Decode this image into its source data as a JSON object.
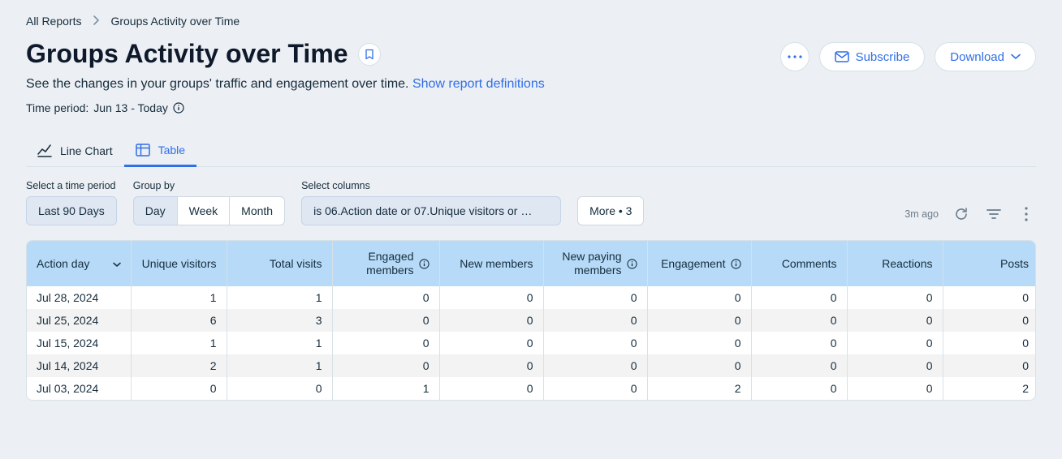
{
  "breadcrumb": {
    "root": "All Reports",
    "current": "Groups Activity over Time"
  },
  "header": {
    "title": "Groups Activity over Time",
    "subtitle": "See the changes in your groups' traffic and engagement over time.",
    "definitions_link": "Show report definitions",
    "time_period_label": "Time period:",
    "time_period_value": "Jun 13 - Today"
  },
  "actions": {
    "subscribe": "Subscribe",
    "download": "Download"
  },
  "tabs": {
    "line_chart": "Line Chart",
    "table": "Table",
    "active": "table"
  },
  "controls": {
    "time_period_label": "Select a time period",
    "time_period_value": "Last 90 Days",
    "group_by_label": "Group by",
    "group_by_options": [
      "Day",
      "Week",
      "Month"
    ],
    "group_by_active": "Day",
    "columns_label": "Select columns",
    "columns_summary": "is 06.Action date or 07.Unique visitors or …",
    "more_label": "More • 3",
    "age": "3m ago"
  },
  "table": {
    "columns": [
      {
        "key": "action_day",
        "label": "Action day",
        "numeric": false,
        "sort": true
      },
      {
        "key": "unique_visitors",
        "label": "Unique visitors",
        "numeric": true
      },
      {
        "key": "total_visits",
        "label": "Total visits",
        "numeric": true
      },
      {
        "key": "engaged_members",
        "label": "Engaged members",
        "numeric": true,
        "info": true,
        "multiline": true
      },
      {
        "key": "new_members",
        "label": "New members",
        "numeric": true
      },
      {
        "key": "new_paying_members",
        "label": "New paying members",
        "numeric": true,
        "info": true,
        "multiline": true
      },
      {
        "key": "engagement",
        "label": "Engagement",
        "numeric": true,
        "info": true
      },
      {
        "key": "comments",
        "label": "Comments",
        "numeric": true
      },
      {
        "key": "reactions",
        "label": "Reactions",
        "numeric": true
      },
      {
        "key": "posts",
        "label": "Posts",
        "numeric": true
      }
    ],
    "rows": [
      {
        "action_day": "Jul 28, 2024",
        "unique_visitors": 1,
        "total_visits": 1,
        "engaged_members": 0,
        "new_members": 0,
        "new_paying_members": 0,
        "engagement": 0,
        "comments": 0,
        "reactions": 0,
        "posts": 0
      },
      {
        "action_day": "Jul 25, 2024",
        "unique_visitors": 6,
        "total_visits": 3,
        "engaged_members": 0,
        "new_members": 0,
        "new_paying_members": 0,
        "engagement": 0,
        "comments": 0,
        "reactions": 0,
        "posts": 0
      },
      {
        "action_day": "Jul 15, 2024",
        "unique_visitors": 1,
        "total_visits": 1,
        "engaged_members": 0,
        "new_members": 0,
        "new_paying_members": 0,
        "engagement": 0,
        "comments": 0,
        "reactions": 0,
        "posts": 0
      },
      {
        "action_day": "Jul 14, 2024",
        "unique_visitors": 2,
        "total_visits": 1,
        "engaged_members": 0,
        "new_members": 0,
        "new_paying_members": 0,
        "engagement": 0,
        "comments": 0,
        "reactions": 0,
        "posts": 0
      },
      {
        "action_day": "Jul 03, 2024",
        "unique_visitors": 0,
        "total_visits": 0,
        "engaged_members": 1,
        "new_members": 0,
        "new_paying_members": 0,
        "engagement": 2,
        "comments": 0,
        "reactions": 0,
        "posts": 2
      }
    ]
  }
}
